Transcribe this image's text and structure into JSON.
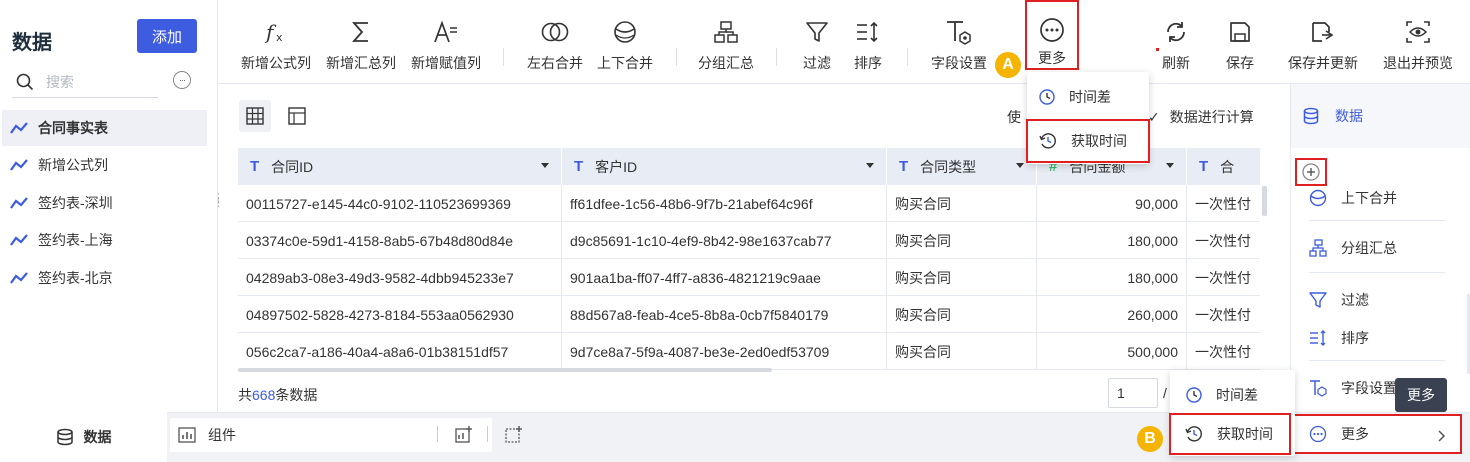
{
  "sidebar": {
    "title": "数据",
    "add_label": "添加",
    "search_placeholder": "搜索",
    "items": [
      {
        "label": "合同事实表",
        "active": true
      },
      {
        "label": "新增公式列"
      },
      {
        "label": "签约表-深圳"
      },
      {
        "label": "签约表-上海"
      },
      {
        "label": "签约表-北京"
      }
    ]
  },
  "toolbar": {
    "items": [
      {
        "label": "新增公式列",
        "icon": "formula-icon"
      },
      {
        "label": "新增汇总列",
        "icon": "sigma-icon"
      },
      {
        "label": "新增赋值列",
        "icon": "assign-icon"
      },
      {
        "label": "左右合并",
        "icon": "merge-lr-icon"
      },
      {
        "label": "上下合并",
        "icon": "merge-ud-icon"
      },
      {
        "label": "分组汇总",
        "icon": "group-icon"
      },
      {
        "label": "过滤",
        "icon": "filter-icon"
      },
      {
        "label": "排序",
        "icon": "sort-icon"
      },
      {
        "label": "字段设置",
        "icon": "field-settings-icon"
      },
      {
        "label": "更多",
        "icon": "more-icon"
      },
      {
        "label": "刷新",
        "icon": "refresh-icon"
      },
      {
        "label": "保存",
        "icon": "save-icon"
      },
      {
        "label": "保存并更新",
        "icon": "save-update-icon"
      },
      {
        "label": "退出并预览",
        "icon": "preview-icon"
      }
    ]
  },
  "calc_text_left": "使",
  "calc_text_right": "数据进行计算",
  "table": {
    "columns": [
      {
        "name": "合同ID",
        "type": "T"
      },
      {
        "name": "客户ID",
        "type": "T"
      },
      {
        "name": "合同类型",
        "type": "T"
      },
      {
        "name": "合同金额",
        "type": "#"
      },
      {
        "name": "合",
        "type": "T"
      }
    ],
    "rows": [
      [
        "00115727-e145-44c0-9102-110523699369",
        "ff61dfee-1c56-48b6-9f7b-21abef64c96f",
        "购买合同",
        "90,000",
        "一次性付"
      ],
      [
        "03374c0e-59d1-4158-8ab5-67b48d80d84e",
        "d9c85691-1c10-4ef9-8b42-98e1637cab77",
        "购买合同",
        "180,000",
        "一次性付"
      ],
      [
        "04289ab3-08e3-49d3-9582-4dbb945233e7",
        "901aa1ba-ff07-4ff7-a836-4821219c9aae",
        "购买合同",
        "180,000",
        "一次性付"
      ],
      [
        "04897502-5828-4273-8184-553aa0562930",
        "88d567a8-feab-4ce5-8b8a-0cb7f5840179",
        "购买合同",
        "260,000",
        "一次性付"
      ],
      [
        "056c2ca7-a186-40a4-a8a6-01b38151df57",
        "9d7ce8a7-5f9a-4087-be3e-2ed0edf53709",
        "购买合同",
        "500,000",
        "一次性付"
      ]
    ]
  },
  "footer": {
    "total_prefix": "共",
    "total_count": "668",
    "total_suffix": "条数据",
    "page_value": "1",
    "page_sep": "/"
  },
  "bottom_tabs": {
    "data_label": "数据",
    "component_label": "组件"
  },
  "more_menu_a": {
    "items": [
      {
        "label": "时间差"
      },
      {
        "label": "获取时间"
      }
    ]
  },
  "right_panel": {
    "header": "数据",
    "items": [
      {
        "label": "上下合并"
      },
      {
        "label": "分组汇总"
      },
      {
        "label": "过滤"
      },
      {
        "label": "排序"
      },
      {
        "label": "字段设置"
      },
      {
        "label": "更多"
      }
    ],
    "tooltip": "更多"
  },
  "more_menu_b": {
    "items": [
      {
        "label": "时间差"
      },
      {
        "label": "获取时间"
      }
    ]
  },
  "badges": {
    "a": "A",
    "b": "B"
  },
  "colors": {
    "accent": "#3d5ce0",
    "highlight": "#e02020",
    "badge": "#f5b400"
  }
}
